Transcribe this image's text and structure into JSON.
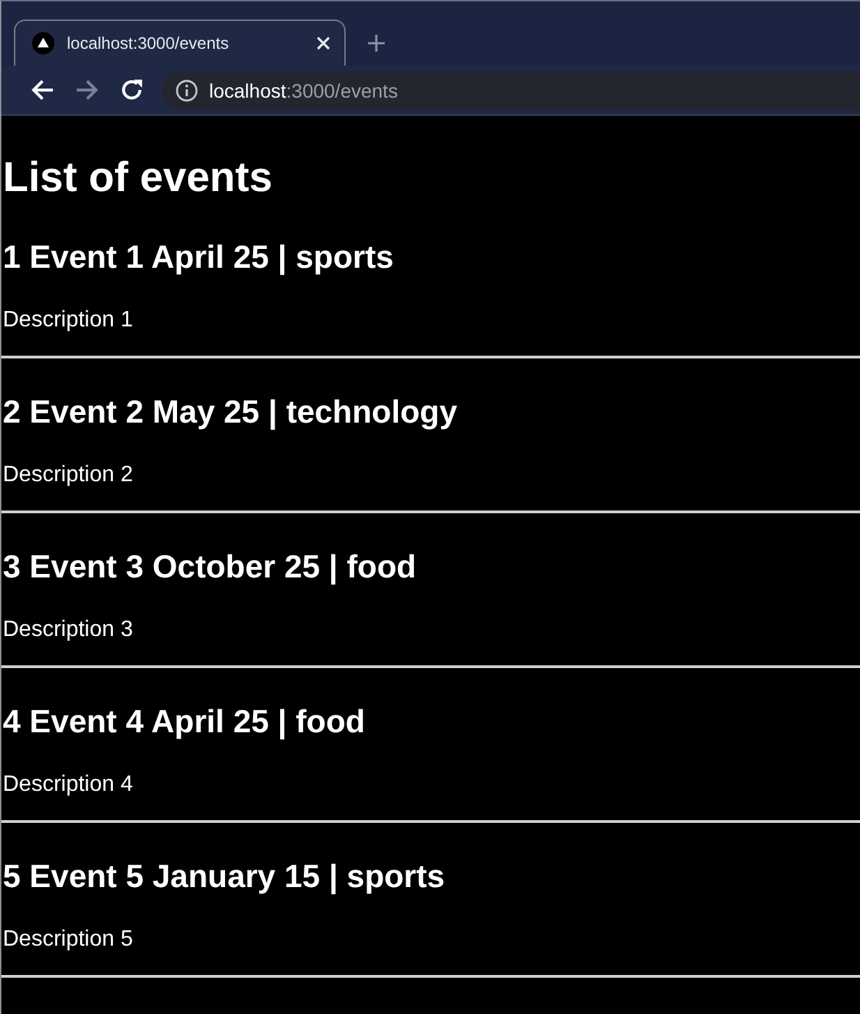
{
  "browser": {
    "tabs": [
      {
        "title": "localhost:3000/events",
        "selected": true
      }
    ],
    "nav_buttons": [
      {
        "kind": "back",
        "disabled": false
      },
      {
        "kind": "forward",
        "disabled": true
      },
      {
        "kind": "reload",
        "disabled": false
      }
    ],
    "address": {
      "host": "localhost",
      "path": ":3000/events"
    }
  },
  "page": {
    "title": "List of events",
    "events": [
      {
        "heading": "1 Event 1 April 25 | sports",
        "description": "Description 1"
      },
      {
        "heading": "2 Event 2 May 25 | technology",
        "description": "Description 2"
      },
      {
        "heading": "3 Event 3 October 25 | food",
        "description": "Description 3"
      },
      {
        "heading": "4 Event 4 April 25 | food",
        "description": "Description 4"
      },
      {
        "heading": "5 Event 5 January 15 | sports",
        "description": "Description 5"
      }
    ]
  }
}
